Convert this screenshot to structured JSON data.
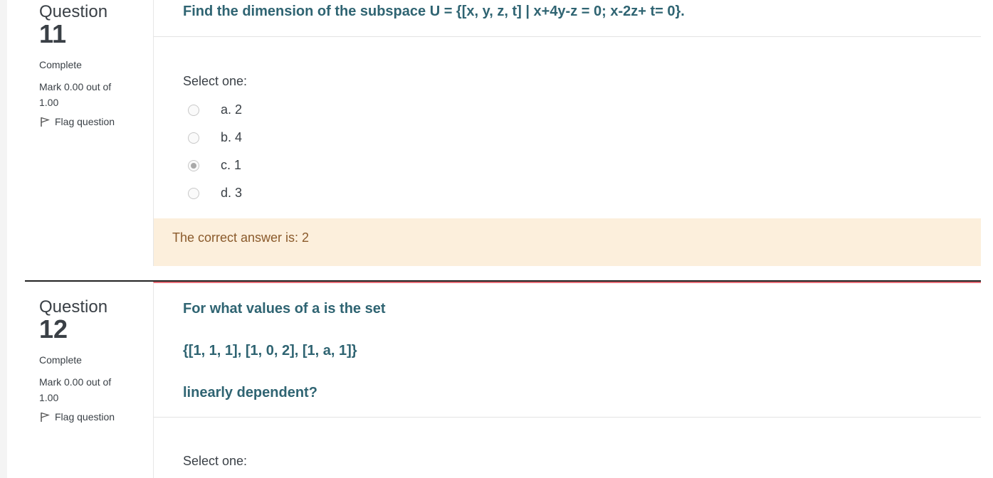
{
  "questions": [
    {
      "label": "Question",
      "number": "11",
      "state": "Complete",
      "grade": "Mark 0.00 out of 1.00",
      "flag_label": "Flag question",
      "text_lines": [
        "Find the dimension of the subspace U = {[x, y, z, t] | x+4y-z = 0; x-2z+ t= 0}."
      ],
      "prompt": "Select one:",
      "options": [
        {
          "label": "a. 2",
          "checked": false
        },
        {
          "label": "b. 4",
          "checked": false
        },
        {
          "label": "c. 1",
          "checked": true
        },
        {
          "label": "d. 3",
          "checked": false
        }
      ],
      "feedback": "The correct answer is: 2"
    },
    {
      "label": "Question",
      "number": "12",
      "state": "Complete",
      "grade": "Mark 0.00 out of 1.00",
      "flag_label": "Flag question",
      "text_lines": [
        "For what values of a is the set",
        "{[1, 1, 1], [1, 0, 2], [1, a, 1]}",
        "linearly dependent?"
      ],
      "prompt": "Select one:"
    }
  ]
}
